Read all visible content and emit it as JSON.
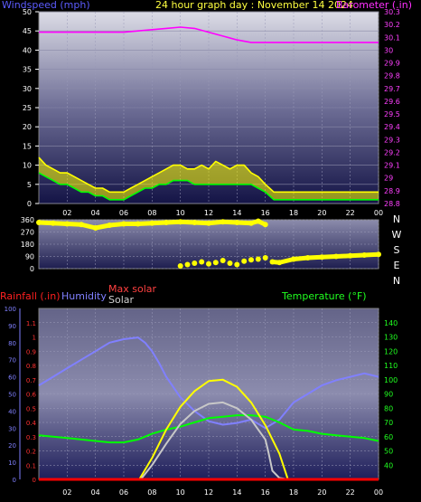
{
  "header": {
    "windspeed_label": "Windspeed (mph)",
    "title": "24 hour graph day : November 14 2024",
    "barometer_label": "Barometer (.in)"
  },
  "direction_labels": [
    "N",
    "W",
    "S",
    "E",
    "N"
  ],
  "lower_labels": {
    "rainfall": "Rainfall (.in)",
    "humidity": "Humidity",
    "max_solar": "Max solar",
    "solar": "Solar",
    "temperature": "Temperature (°F)"
  },
  "colors": {
    "wind": "#ffff00",
    "gust": "#00ff00",
    "barometer": "#ff00ff",
    "direction": "#ffff00",
    "rain": "#ff0000",
    "humidity": "#8080ff",
    "max_solar": "#ffff00",
    "solar": "#c8c8c8",
    "temperature": "#00ff00"
  },
  "chart_data": [
    {
      "type": "line",
      "name": "wind",
      "xlim": [
        0,
        24
      ],
      "x_ticks": [
        "02",
        "04",
        "06",
        "08",
        "10",
        "12",
        "14",
        "16",
        "18",
        "20",
        "22",
        "00"
      ],
      "ylim": [
        0,
        50
      ],
      "y_ticks": [
        0,
        5,
        10,
        15,
        20,
        25,
        30,
        35,
        40,
        45,
        50
      ],
      "y2lim": [
        28.8,
        30.3
      ],
      "y2_ticks": [
        "28.8",
        "28.9",
        "29",
        "29.1",
        "29.2",
        "29.3",
        "29.4",
        "29.5",
        "29.6",
        "29.7",
        "29.8",
        "29.9",
        "30",
        "30.1",
        "30.2",
        "30.3"
      ],
      "series": [
        {
          "key": "wind",
          "x": [
            0,
            0.5,
            1,
            1.5,
            2,
            2.5,
            3,
            3.5,
            4,
            4.5,
            5,
            5.5,
            6,
            6.5,
            7,
            7.5,
            8,
            8.5,
            9,
            9.5,
            10,
            10.5,
            11,
            11.5,
            12,
            12.5,
            13,
            13.5,
            14,
            14.5,
            15,
            15.5,
            16,
            16.3,
            16.6,
            17,
            18,
            19,
            20,
            21,
            22,
            23,
            24
          ],
          "y": [
            12,
            10,
            9,
            8,
            8,
            7,
            6,
            5,
            4,
            4,
            3,
            3,
            3,
            4,
            5,
            6,
            7,
            8,
            9,
            10,
            10,
            9,
            9,
            10,
            9,
            11,
            10,
            9,
            10,
            10,
            8,
            7,
            5,
            4,
            3,
            3,
            3,
            3,
            3,
            3,
            3,
            3,
            3
          ]
        },
        {
          "key": "gust",
          "x": [
            0,
            0.5,
            1,
            1.5,
            2,
            2.5,
            3,
            3.5,
            4,
            4.5,
            5,
            5.5,
            6,
            6.5,
            7,
            7.5,
            8,
            8.5,
            9,
            9.5,
            10,
            10.5,
            11,
            11.5,
            12,
            12.5,
            13,
            13.5,
            14,
            14.5,
            15,
            15.5,
            16,
            16.3,
            16.6,
            17,
            18,
            19,
            20,
            21,
            22,
            23,
            24
          ],
          "y": [
            8,
            7,
            6,
            5,
            5,
            4,
            3,
            3,
            2,
            2,
            1,
            1,
            1,
            2,
            3,
            4,
            4,
            5,
            5,
            6,
            6,
            6,
            5,
            5,
            5,
            5,
            5,
            5,
            5,
            5,
            5,
            4,
            3,
            2,
            1,
            1,
            1,
            1,
            1,
            1,
            1,
            1,
            1
          ]
        },
        {
          "key": "barometer",
          "axis": "y2",
          "x": [
            0,
            2,
            4,
            6,
            8,
            9,
            10,
            11,
            12,
            13,
            14,
            15,
            16,
            17,
            18,
            20,
            22,
            24
          ],
          "y": [
            30.14,
            30.14,
            30.14,
            30.14,
            30.16,
            30.17,
            30.18,
            30.17,
            30.14,
            30.11,
            30.08,
            30.06,
            30.06,
            30.06,
            30.06,
            30.06,
            30.06,
            30.06
          ]
        }
      ]
    },
    {
      "type": "scatter",
      "name": "direction",
      "xlim": [
        0,
        24
      ],
      "ylim": [
        0,
        360
      ],
      "y_ticks": [
        0,
        90,
        180,
        270,
        360
      ],
      "series": [
        {
          "key": "direction",
          "x": [
            0,
            1,
            2,
            3,
            4,
            5,
            6,
            7,
            8,
            9,
            10,
            11,
            12,
            13,
            14,
            15,
            15.5,
            16,
            16.5,
            17,
            18,
            19,
            20,
            21,
            22,
            23,
            24
          ],
          "y": [
            340,
            335,
            330,
            325,
            300,
            320,
            330,
            330,
            335,
            340,
            345,
            340,
            335,
            345,
            340,
            335,
            350,
            325,
            50,
            45,
            70,
            80,
            85,
            90,
            95,
            100,
            105
          ]
        },
        {
          "key": "direction_afternoon",
          "x": [
            10,
            10.5,
            11,
            11.5,
            12,
            12.5,
            13,
            13.5,
            14,
            14.5,
            15,
            15.5,
            16
          ],
          "y": [
            20,
            30,
            40,
            50,
            35,
            45,
            60,
            40,
            30,
            55,
            65,
            70,
            80
          ]
        }
      ]
    },
    {
      "type": "line",
      "name": "climate",
      "xlim": [
        0,
        24
      ],
      "rain_ylim": [
        0,
        1.2
      ],
      "rain_ticks": [
        "0",
        "0.1",
        "0.2",
        "0.3",
        "0.4",
        "0.5",
        "0.6",
        "0.7",
        "0.8",
        "0.9",
        "1",
        "1.1"
      ],
      "humidity_ylim": [
        0,
        100
      ],
      "humidity_ticks": [
        0,
        10,
        20,
        30,
        40,
        50,
        60,
        70,
        80,
        90,
        100
      ],
      "temp_ylim": [
        30,
        150
      ],
      "temp_ticks": [
        40,
        50,
        60,
        70,
        80,
        90,
        100,
        110,
        120,
        130,
        140
      ],
      "series": [
        {
          "key": "humidity",
          "x": [
            0,
            1,
            2,
            3,
            4,
            5,
            6,
            7,
            7.5,
            8,
            8.5,
            9,
            10,
            11,
            12,
            13,
            14,
            15,
            16,
            17,
            18,
            19,
            20,
            21,
            22,
            23,
            24
          ],
          "y": [
            55,
            60,
            65,
            70,
            75,
            80,
            82,
            83,
            80,
            75,
            68,
            60,
            48,
            40,
            34,
            32,
            33,
            35,
            30,
            35,
            45,
            50,
            55,
            58,
            60,
            62,
            60
          ]
        },
        {
          "key": "temperature",
          "x": [
            0,
            1,
            2,
            3,
            4,
            5,
            6,
            7,
            8,
            9,
            10,
            11,
            12,
            13,
            14,
            15,
            16,
            17,
            18,
            19,
            20,
            21,
            22,
            23,
            24
          ],
          "y": [
            61,
            60,
            59,
            58,
            57,
            56,
            56,
            58,
            62,
            65,
            67,
            70,
            73,
            74,
            75,
            75,
            74,
            70,
            65,
            64,
            62,
            61,
            60,
            59,
            57
          ]
        },
        {
          "key": "max_solar",
          "x": [
            7.1,
            8,
            9,
            10,
            11,
            12,
            13,
            14,
            15,
            16,
            17,
            17.6
          ],
          "y": [
            0,
            150,
            350,
            510,
            620,
            690,
            700,
            650,
            540,
            380,
            180,
            0
          ]
        },
        {
          "key": "solar",
          "x": [
            7.2,
            8,
            9,
            10,
            11,
            12,
            13,
            14,
            15,
            15.5,
            16,
            16.2,
            16.5,
            17,
            17.6
          ],
          "y": [
            0,
            100,
            250,
            390,
            480,
            530,
            540,
            500,
            420,
            350,
            280,
            200,
            60,
            10,
            0
          ]
        },
        {
          "key": "rain",
          "x": [
            0,
            24
          ],
          "y": [
            0,
            0
          ]
        }
      ]
    }
  ]
}
